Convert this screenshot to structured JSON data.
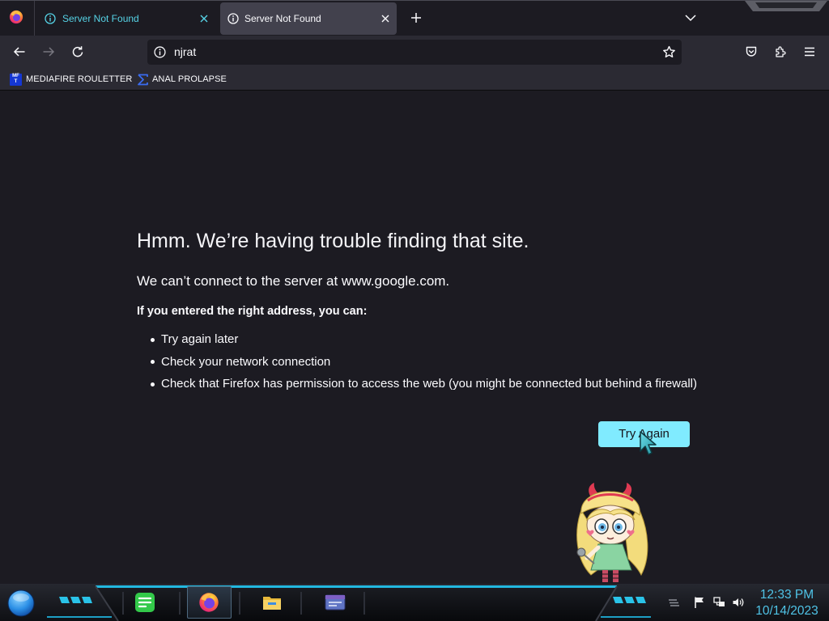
{
  "tabs": [
    {
      "title": "Server Not Found",
      "icon": "info-icon",
      "close_icon": "close-icon",
      "selected": false
    },
    {
      "title": "Server Not Found",
      "icon": "info-icon",
      "close_icon": "close-icon",
      "selected": true
    }
  ],
  "tabstrip": {
    "browser_icon": "firefox-logo-icon",
    "new_tab_icon": "plus-icon",
    "list_tabs_icon": "chevron-down-icon"
  },
  "navbar": {
    "back_icon": "back-arrow-icon",
    "forward_icon": "forward-arrow-icon",
    "forward_enabled": false,
    "reload_icon": "reload-icon",
    "identity_icon": "info-icon",
    "url": "njrat",
    "bookmark_icon": "star-icon",
    "pocket_icon": "pocket-icon",
    "extensions_icon": "puzzle-piece-icon",
    "menu_icon": "hamburger-menu-icon"
  },
  "bookmarks": [
    {
      "label": "MEDIAFIRE ROULETTER",
      "favicon_text_top": "MF",
      "favicon_text_bottom": "T",
      "favicon_color": "#1537d4"
    },
    {
      "label": "ANAL PROLAPSE",
      "favicon": "sigma-bracket-icon",
      "favicon_color": "#3a6cf0"
    }
  ],
  "error_page": {
    "title": "Hmm. We’re having trouble finding that site.",
    "subtitle": "We can’t connect to the server at www.google.com.",
    "suggestion_heading": "If you entered the right address, you can:",
    "suggestions": [
      "Try again later",
      "Check your network connection",
      "Check that Firefox has permission to access the web (you might be connected but behind a firewall)"
    ],
    "try_again_label": "Try Again"
  },
  "desktop": {
    "mascot_icon": "cartoon-girl-mascot-icon",
    "cursor_icon": "arrow-cursor-icon"
  },
  "taskbar": {
    "start_icon": "start-orb-icon",
    "apps": [
      {
        "icon": "notes-icon",
        "active": false
      },
      {
        "icon": "firefox-logo-icon",
        "active": true
      },
      {
        "icon": "folder-icon",
        "active": false
      },
      {
        "icon": "window-app-icon",
        "active": false
      }
    ],
    "tray_icons": [
      "tray-overflow-icon",
      "flag-icon",
      "network-icon",
      "volume-icon"
    ],
    "clock": {
      "time": "12:33 PM",
      "date": "10/14/2023"
    }
  },
  "colors": {
    "page_background": "#1c1b22",
    "selected_tab": "#42414d",
    "highlighted_tab_text": "#56d3e6",
    "button_accent": "#80ebff",
    "taskbar_accent": "#22b8e0",
    "clock_text": "#4fc3e6"
  }
}
